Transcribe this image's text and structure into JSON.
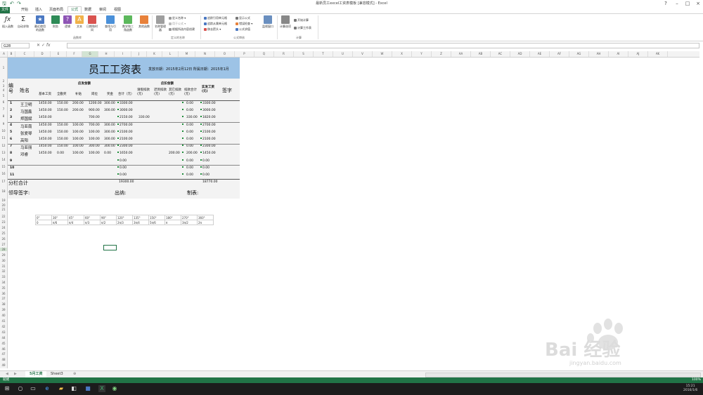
{
  "app": {
    "title": "最新员工excel工资表模板 [兼容模式] - Excel",
    "colors": {
      "accent": "#217346",
      "header_blue": "#9dc3e6"
    }
  },
  "tabs": [
    "文件",
    "开始",
    "插入",
    "页面布局",
    "公式",
    "数据",
    "审阅",
    "视图"
  ],
  "active_tab": "公式",
  "ribbon": {
    "buttons": [
      {
        "label": "插入函数",
        "icon": "fx-icon"
      },
      {
        "label": "自动求和",
        "icon": "sigma-icon"
      },
      {
        "label": "最近使用的函数",
        "icon": "star-icon"
      },
      {
        "label": "财务",
        "icon": "book-icon"
      },
      {
        "label": "逻辑",
        "icon": "question-icon"
      },
      {
        "label": "文本",
        "icon": "text-icon"
      },
      {
        "label": "日期和时间",
        "icon": "calendar-icon"
      },
      {
        "label": "查找与引用",
        "icon": "lookup-icon"
      },
      {
        "label": "数学和三角函数",
        "icon": "math-icon"
      },
      {
        "label": "其他函数",
        "icon": "more-icon"
      },
      {
        "label": "名称管理器",
        "icon": "tag-icon"
      },
      {
        "label": "监视窗口",
        "icon": "watch-icon"
      },
      {
        "label": "计算选项",
        "icon": "calc-icon"
      }
    ],
    "small": {
      "define_name": "定义名称",
      "use_in_formula": "用于公式",
      "create_from_selection": "根据所选内容创建",
      "trace_precedents": "追踪引用单元格",
      "trace_dependents": "追踪从属单元格",
      "remove_arrows": "移去箭头",
      "show_formulas": "显示公式",
      "error_checking": "错误检查",
      "evaluate_formula": "公式求值",
      "calc_now": "开始计算",
      "calc_sheet": "计算工作表"
    },
    "groups": {
      "library": "函数库",
      "names": "定义的名称",
      "auditing": "公式审核",
      "calculation": "计算"
    }
  },
  "formula_bar": {
    "name_box": "G28",
    "fx": "fx"
  },
  "columns": [
    "A",
    "B",
    "C",
    "D",
    "E",
    "F",
    "G",
    "H",
    "I",
    "J",
    "K",
    "L",
    "M",
    "N",
    "O",
    "P",
    "Q",
    "R",
    "S",
    "T",
    "U",
    "V",
    "W",
    "X",
    "Y",
    "Z",
    "AA",
    "AB",
    "AC",
    "AD",
    "AE",
    "AF",
    "AG",
    "AH",
    "AI",
    "AJ",
    "AK"
  ],
  "rows": [
    "1",
    "2",
    "3",
    "4",
    "5",
    "6",
    "7",
    "8",
    "9",
    "10",
    "11",
    "12",
    "13",
    "14",
    "15",
    "16",
    "17",
    "18",
    "19",
    "20",
    "21",
    "22",
    "23",
    "24",
    "25",
    "26",
    "27",
    "28",
    "29",
    "30",
    "31",
    "32",
    "33",
    "34",
    "35",
    "36",
    "37",
    "38",
    "39",
    "40",
    "41",
    "42",
    "43",
    "44",
    "45",
    "46",
    "47",
    "48",
    "49",
    "50",
    "51",
    "52",
    "53"
  ],
  "salary": {
    "title": "员工工资表",
    "date": "发放日期：2015年2月12日  所属日期：2015年1月",
    "h_no": "编号",
    "h_name": "姓名",
    "h_payable": "应发金额",
    "h_deduct": "应扣金额",
    "h_basic": "基本工资",
    "h_seniority": "全勤奖",
    "h_allowance": "补贴",
    "h_post": "岗位",
    "h_bonus": "奖金",
    "h_total": "合计（元）",
    "h_late": "请假扣款(元)",
    "h_absent": "迟到扣款(元)",
    "h_other": "其它扣款(元)",
    "h_deduct_total": "扣款合计(元)",
    "h_actual": "实发工资(元)",
    "h_sign": "签字",
    "rows": [
      {
        "no": "1",
        "name": "王卫明",
        "basic": "1450.00",
        "seniority": "150.00",
        "allowance": "200.00",
        "post": "1200.00",
        "bonus": "300.00",
        "total": "3300.00",
        "late": "",
        "absent": "",
        "other": "",
        "dtotal": "0.00",
        "actual": "3300.00"
      },
      {
        "no": "2",
        "name": "马国鑫",
        "basic": "1450.00",
        "seniority": "150.00",
        "allowance": "200.00",
        "post": "900.00",
        "bonus": "300.00",
        "total": "3000.00",
        "late": "",
        "absent": "",
        "other": "",
        "dtotal": "0.00",
        "actual": "3000.00"
      },
      {
        "no": "3",
        "name": "郑国斌",
        "basic": "1450.00",
        "seniority": "",
        "allowance": "",
        "post": "700.00",
        "bonus": "",
        "total": "2150.00",
        "late": "330.00",
        "absent": "",
        "other": "",
        "dtotal": "330.00",
        "actual": "1820.00"
      },
      {
        "no": "4",
        "name": "马亚南",
        "basic": "1450.00",
        "seniority": "150.00",
        "allowance": "100.00",
        "post": "700.00",
        "bonus": "300.00",
        "total": "2700.00",
        "late": "",
        "absent": "",
        "other": "",
        "dtotal": "0.00",
        "actual": "2700.00"
      },
      {
        "no": "5",
        "name": "张爱琴",
        "basic": "1450.00",
        "seniority": "150.00",
        "allowance": "100.00",
        "post": "100.00",
        "bonus": "300.00",
        "total": "2100.00",
        "late": "",
        "absent": "",
        "other": "",
        "dtotal": "0.00",
        "actual": "2100.00"
      },
      {
        "no": "6",
        "name": "高阳",
        "basic": "1450.00",
        "seniority": "150.00",
        "allowance": "100.00",
        "post": "100.00",
        "bonus": "300.00",
        "total": "2100.00",
        "late": "",
        "absent": "",
        "other": "",
        "dtotal": "0.00",
        "actual": "2100.00"
      },
      {
        "no": "7",
        "name": "马亚丽",
        "basic": "1450.00",
        "seniority": "150.00",
        "allowance": "100.00",
        "post": "300.00",
        "bonus": "300.00",
        "total": "2300.00",
        "late": "",
        "absent": "",
        "other": "",
        "dtotal": "0.00",
        "actual": "2300.00"
      },
      {
        "no": "8",
        "name": "邓睿",
        "basic": "1450.00",
        "seniority": "0.00",
        "allowance": "100.00",
        "post": "100.00",
        "bonus": "0.00",
        "total": "1650.00",
        "late": "",
        "absent": "",
        "other": "200.00",
        "dtotal": "200.00",
        "actual": "1450.00"
      },
      {
        "no": "9",
        "name": "",
        "basic": "",
        "seniority": "",
        "allowance": "",
        "post": "",
        "bonus": "",
        "total": "0.00",
        "late": "",
        "absent": "",
        "other": "",
        "dtotal": "0.00",
        "actual": "0.00"
      },
      {
        "no": "10",
        "name": "",
        "basic": "",
        "seniority": "",
        "allowance": "",
        "post": "",
        "bonus": "",
        "total": "0.00",
        "late": "",
        "absent": "",
        "other": "",
        "dtotal": "0.00",
        "actual": "0.00"
      },
      {
        "no": "11",
        "name": "",
        "basic": "",
        "seniority": "",
        "allowance": "",
        "post": "",
        "bonus": "",
        "total": "0.00",
        "late": "",
        "absent": "",
        "other": "",
        "dtotal": "0.00",
        "actual": "0.00"
      }
    ],
    "subtotal_label": "分栏合计",
    "subtotal_total": "19300.00",
    "subtotal_actual": "18770.00",
    "leader_sign": "领导签字:",
    "cashier": "出纳:",
    "maker": "制表:"
  },
  "angle_table": {
    "row1": [
      "0°",
      "30°",
      "45°",
      "60°",
      "90°",
      "120°",
      "135°",
      "150°",
      "180°",
      "270°",
      "360°"
    ],
    "row2": [
      "0",
      "π/6",
      "π/4",
      "π/3",
      "π/2",
      "2π/3",
      "3π/4",
      "5π/6",
      "π",
      "3π/2",
      "2π"
    ]
  },
  "sheet_tabs": [
    "5月工资",
    "Sheet3"
  ],
  "active_sheet": "5月工资",
  "status": {
    "left": "就绪",
    "zoom": "100%"
  },
  "watermark": {
    "text": "Bai 经验",
    "url": "jingyan.baidu.com"
  },
  "clock": {
    "time": "15:21",
    "date": "2016/1/6"
  }
}
